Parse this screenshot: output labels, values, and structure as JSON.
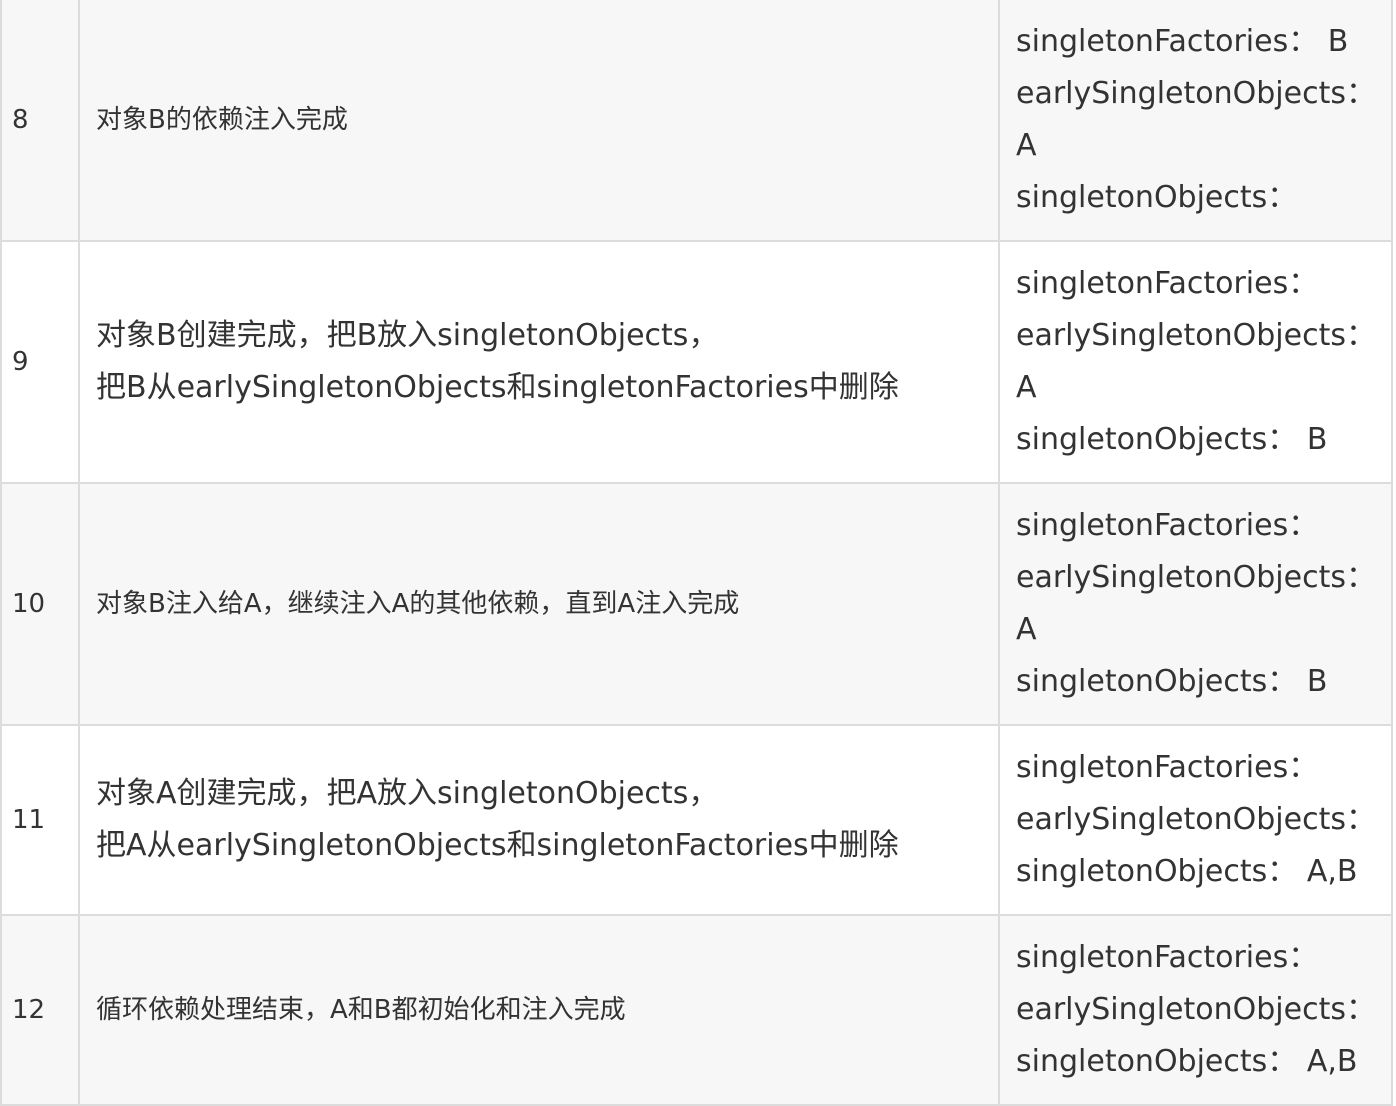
{
  "rows": [
    {
      "step": "8",
      "desc": [
        "对象B的依赖注入完成"
      ],
      "state": [
        "singletonFactories： B",
        "earlySingletonObjects：",
        "A",
        "singletonObjects："
      ]
    },
    {
      "step": "9",
      "desc": [
        "对象B创建完成，把B放入singletonObjects，",
        "把B从earlySingletonObjects和singletonFactories中删除"
      ],
      "state": [
        "singletonFactories：",
        "earlySingletonObjects：",
        "A",
        "singletonObjects： B"
      ]
    },
    {
      "step": "10",
      "desc": [
        "对象B注入给A，继续注入A的其他依赖，直到A注入完成"
      ],
      "state": [
        "singletonFactories：",
        "earlySingletonObjects：",
        "A",
        "singletonObjects： B"
      ]
    },
    {
      "step": "11",
      "desc": [
        "对象A创建完成，把A放入singletonObjects，",
        "把A从earlySingletonObjects和singletonFactories中删除"
      ],
      "state": [
        "singletonFactories：",
        "earlySingletonObjects：",
        "singletonObjects： A,B"
      ]
    },
    {
      "step": "12",
      "desc": [
        "循环依赖处理结束，A和B都初始化和注入完成"
      ],
      "state": [
        "singletonFactories：",
        "earlySingletonObjects：",
        "singletonObjects： A,B"
      ]
    }
  ]
}
